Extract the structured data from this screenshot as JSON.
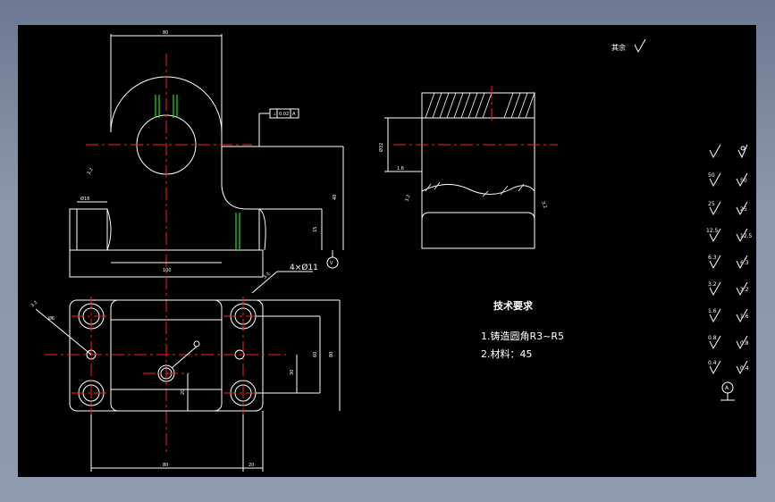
{
  "tech_req": {
    "title": "技术要求",
    "item1": "1.铸造圆角R3~R5",
    "item2": "2.材料：45"
  },
  "callouts": {
    "holes": "4×Ø11",
    "other_finish": "其余",
    "datum": "A",
    "view_marker": "V"
  },
  "roughness_values": [
    "Ra",
    "50",
    "25",
    "12.5",
    "6.3",
    "3.2",
    "1.6",
    "0.8",
    "0.4"
  ],
  "colors": {
    "background": "#000000",
    "outline": "#ffffff",
    "centerline": "#ff2020",
    "highlight": "#22dd22"
  }
}
